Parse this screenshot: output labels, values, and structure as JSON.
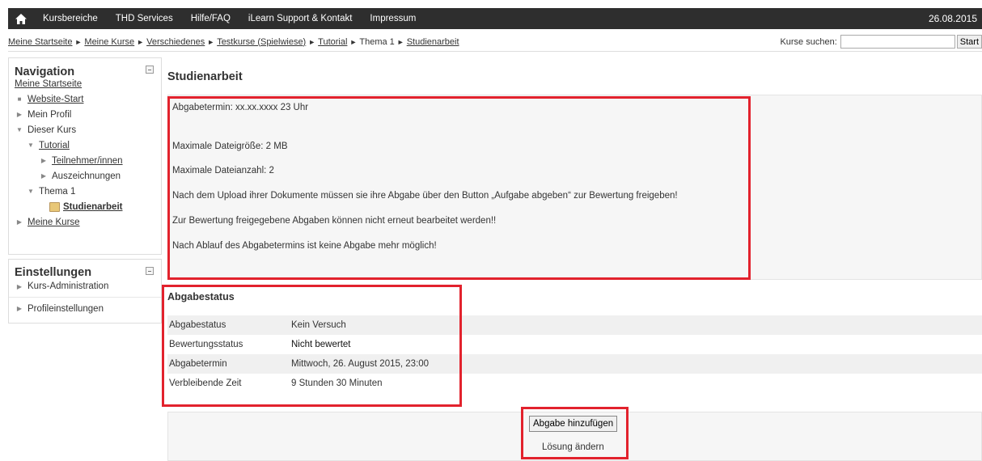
{
  "topbar": {
    "items": [
      "Kursbereiche",
      "THD Services",
      "Hilfe/FAQ",
      "iLearn Support & Kontakt",
      "Impressum"
    ],
    "date": "26.08.2015"
  },
  "breadcrumb": {
    "items": [
      "Meine Startseite",
      "Meine Kurse",
      "Verschiedenes",
      "Testkurse (Spielwiese)",
      "Tutorial",
      "Thema 1",
      "Studienarbeit"
    ],
    "separator": "►"
  },
  "search": {
    "label": "Kurse suchen:",
    "value": "",
    "button": "Start"
  },
  "navigation": {
    "title": "Navigation",
    "home": "Meine Startseite",
    "items": [
      "Website-Start",
      "Mein Profil",
      "Dieser Kurs",
      "Tutorial",
      "Teilnehmer/innen",
      "Auszeichnungen",
      "Thema 1",
      "Studienarbeit",
      "Meine Kurse"
    ]
  },
  "settings": {
    "title": "Einstellungen",
    "items": [
      "Kurs-Administration",
      "Profileinstellungen"
    ]
  },
  "main": {
    "title": "Studienarbeit",
    "intro": [
      "Abgabetermin: xx.xx.xxxx 23 Uhr",
      "Maximale Dateigröße: 2 MB",
      "Maximale Dateianzahl: 2",
      "Nach dem Upload ihrer Dokumente müssen sie ihre Abgabe über den Button „Aufgabe abgeben“ zur Bewertung freigeben!",
      "Zur Bewertung freigegebene Abgaben können nicht erneut bearbeitet werden!!",
      "Nach Ablauf des Abgabetermins ist keine Abgabe mehr möglich!"
    ],
    "status_title": "Abgabestatus",
    "status_rows": [
      {
        "key": "Abgabestatus",
        "value": "Kein Versuch"
      },
      {
        "key": "Bewertungsstatus",
        "value": "Nicht bewertet"
      },
      {
        "key": "Abgabetermin",
        "value": "Mittwoch, 26. August 2015, 23:00"
      },
      {
        "key": "Verbleibende Zeit",
        "value": "9 Stunden 30 Minuten"
      }
    ],
    "add_button": "Abgabe hinzufügen",
    "change_text": "Lösung ändern"
  },
  "colors": {
    "topbar": "#2e2e2e",
    "highlight": "#e2222d"
  }
}
